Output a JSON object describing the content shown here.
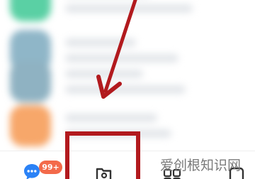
{
  "chat_list": {
    "rows": [
      {
        "avatar_color": "#5ad0a4"
      },
      {
        "avatar_color": "#8fb6c8"
      },
      {
        "avatar_color": "#8fb2c2"
      },
      {
        "avatar_color": "#f7a76a"
      }
    ]
  },
  "tab_bar": {
    "messages_badge": "99+",
    "badge_color": "#f36a4a",
    "accent_color": "#2b82f6"
  },
  "annotation": {
    "color": "#b21a1e"
  },
  "watermark": {
    "text": "爱创根知识网"
  }
}
